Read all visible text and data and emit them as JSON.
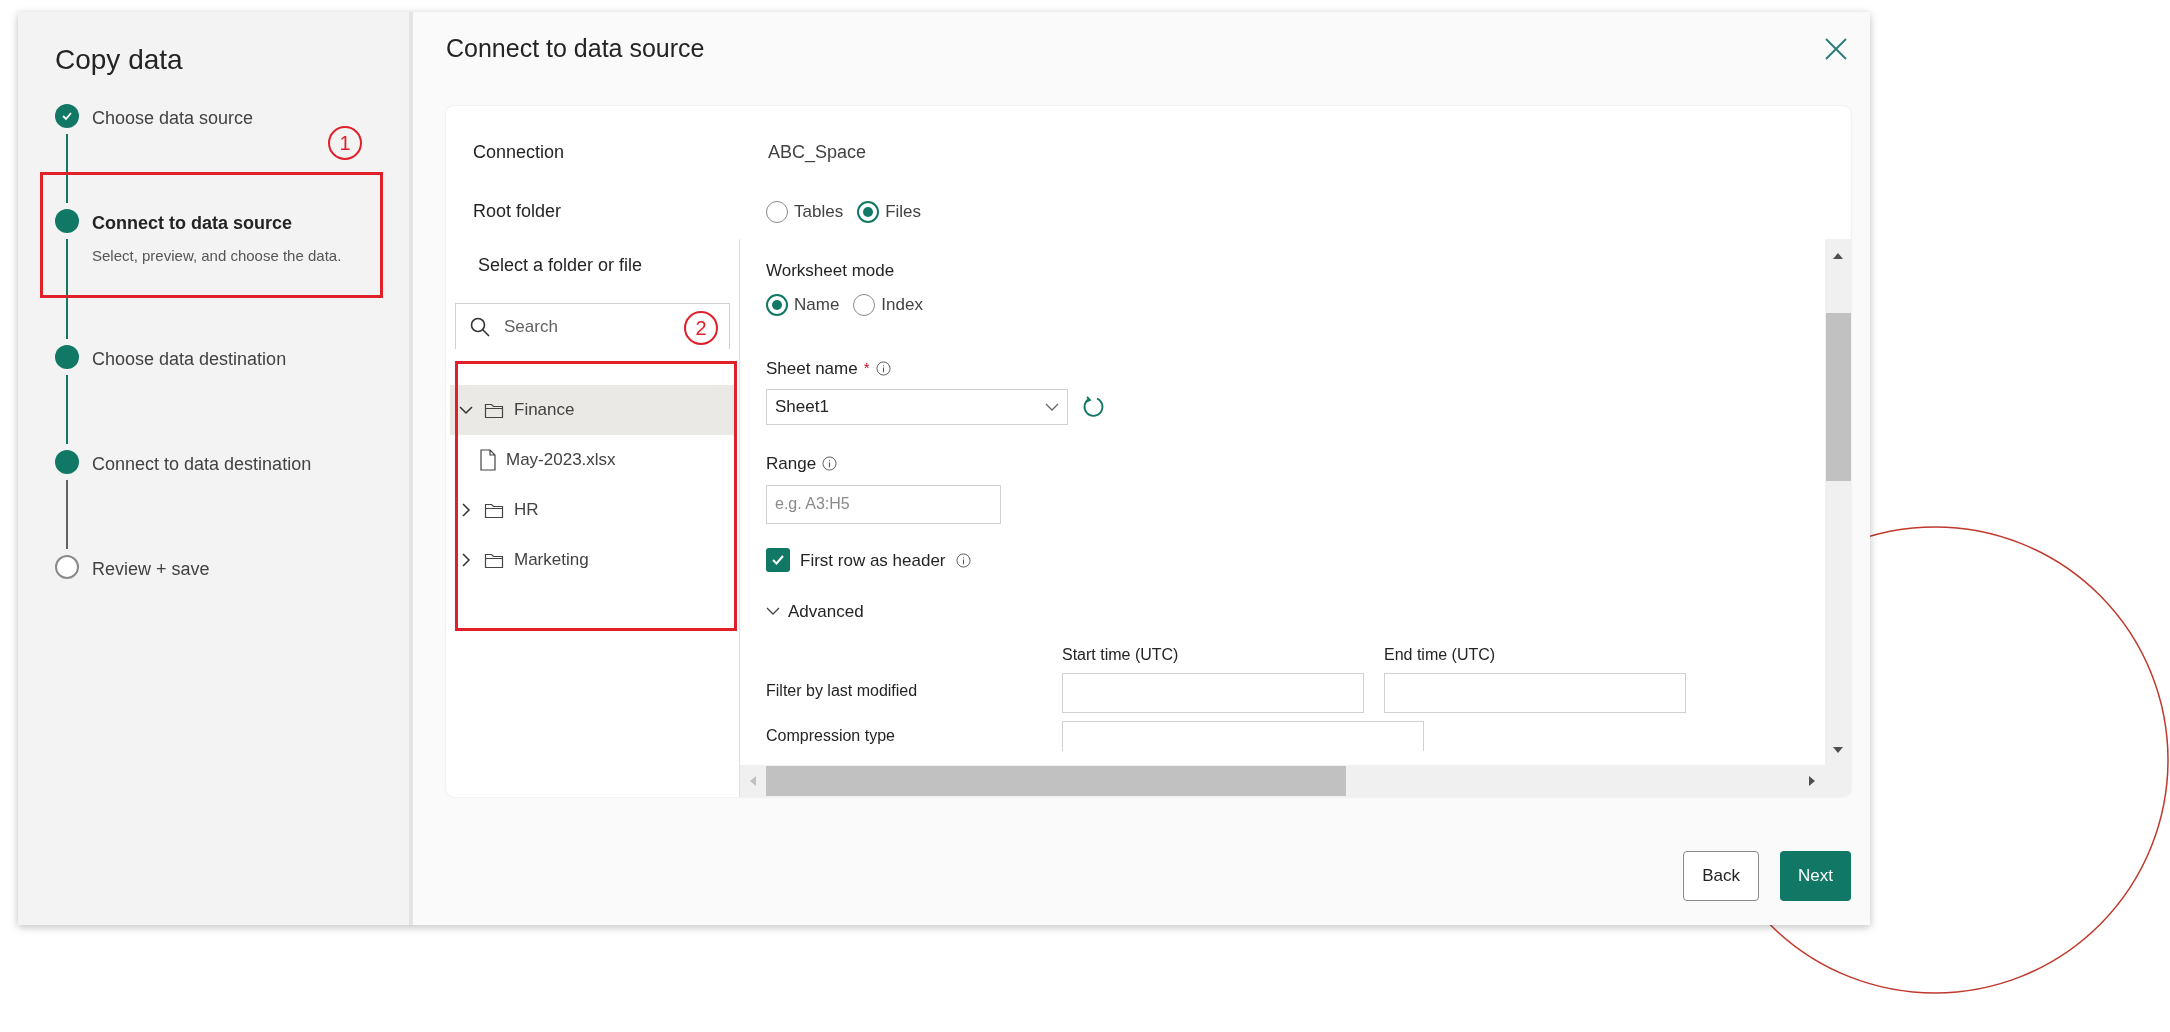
{
  "sidebar": {
    "title": "Copy data",
    "steps": [
      {
        "label": "Choose data source",
        "checked": true,
        "filled": true,
        "selected": false
      },
      {
        "label": "Connect to data source",
        "description": "Select, preview, and choose the data.",
        "checked": false,
        "filled": true,
        "selected": true
      },
      {
        "label": "Choose data destination",
        "checked": false,
        "filled": true,
        "selected": false
      },
      {
        "label": "Connect to data destination",
        "checked": false,
        "filled": true,
        "selected": false
      },
      {
        "label": "Review + save",
        "checked": false,
        "filled": false,
        "selected": false
      }
    ]
  },
  "annotations": {
    "step_marker": "1",
    "tree_marker": "2"
  },
  "dialog": {
    "title": "Connect to data source",
    "connection": {
      "label": "Connection",
      "value": "ABC_Space"
    },
    "root_folder": {
      "label": "Root folder",
      "options": [
        {
          "label": "Tables",
          "selected": false
        },
        {
          "label": "Files",
          "selected": true
        }
      ]
    },
    "browser": {
      "title": "Select a folder or file",
      "search": {
        "placeholder": "Search"
      },
      "tree": [
        {
          "label": "Finance",
          "kind": "folder",
          "expanded": true,
          "selected": true,
          "children": [
            {
              "label": "May-2023.xlsx",
              "kind": "file",
              "selected": false
            }
          ]
        },
        {
          "label": "HR",
          "kind": "folder",
          "expanded": false,
          "selected": false
        },
        {
          "label": "Marketing",
          "kind": "folder",
          "expanded": false,
          "selected": false
        }
      ]
    },
    "settings": {
      "worksheet_mode": {
        "label": "Worksheet mode",
        "options": [
          {
            "label": "Name",
            "selected": true
          },
          {
            "label": "Index",
            "selected": false
          }
        ]
      },
      "sheet_name": {
        "label": "Sheet name",
        "required_mark": "*",
        "value": "Sheet1"
      },
      "range": {
        "label": "Range",
        "placeholder": "e.g. A3:H5"
      },
      "first_row_header": {
        "label": "First row as header",
        "checked": true
      },
      "advanced": {
        "label": "Advanced",
        "expanded": true
      },
      "filter": {
        "label": "Filter by last modified",
        "start_label": "Start time (UTC)",
        "end_label": "End time (UTC)"
      },
      "compression": {
        "label": "Compression type"
      }
    },
    "buttons": [
      {
        "label": "Back",
        "kind": "secondary"
      },
      {
        "label": "Next",
        "kind": "primary"
      }
    ]
  }
}
